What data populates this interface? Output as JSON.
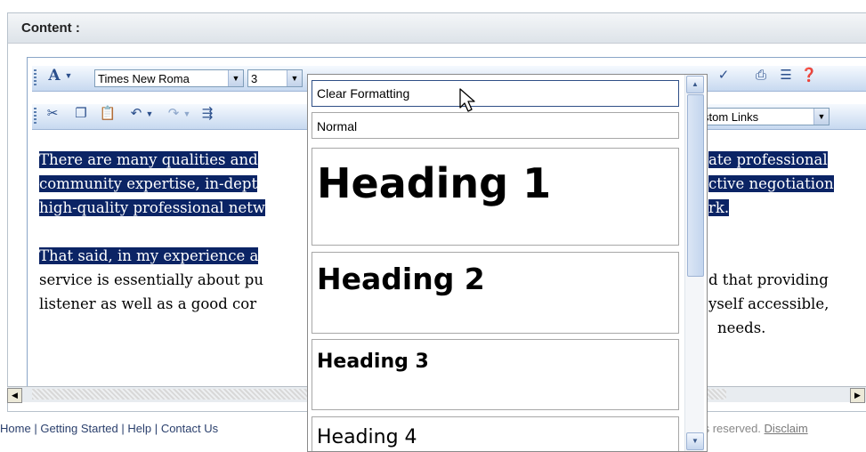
{
  "panel": {
    "title": "Content :"
  },
  "toolbar1": {
    "font_name": "Times New Roma",
    "font_size": "3"
  },
  "toolbar2": {
    "custom_links": "stom Links"
  },
  "editor": {
    "lines": [
      {
        "left": "There are many qualities and",
        "right": "ate professional "
      },
      {
        "left": "community expertise, in-dept",
        "right": "ctive negotiation"
      },
      {
        "left": "high-quality professional netw",
        "right": "rk."
      },
      {
        "left": "That said, in my experience a",
        "right": "d that providing"
      },
      {
        "left": "service is essentially about pu",
        "right": "yself accessible, "
      },
      {
        "left": "listener as well as a good cor",
        "right": "needs."
      }
    ]
  },
  "dropdown": {
    "items": [
      {
        "label": "Clear Formatting"
      },
      {
        "label": "Normal"
      },
      {
        "label": "Heading 1"
      },
      {
        "label": "Heading 2"
      },
      {
        "label": "Heading 3"
      },
      {
        "label": "Heading 4"
      }
    ]
  },
  "footer": {
    "links": [
      "Home",
      "Getting Started",
      "Help",
      "Contact Us"
    ],
    "rights": "ts reserved.",
    "disclaimer": "Disclaim"
  },
  "colors": {
    "selection": "#0b2465",
    "toolbar": "#c7d9f0",
    "link": "#2a3f6c"
  },
  "icons": [
    "font-color-icon",
    "cut-icon",
    "copy-icon",
    "paste-icon",
    "undo-icon",
    "redo-icon",
    "indent-icon",
    "spellcheck-icon",
    "print-icon",
    "list-icon",
    "help-icon",
    "mouse-cursor-icon"
  ]
}
